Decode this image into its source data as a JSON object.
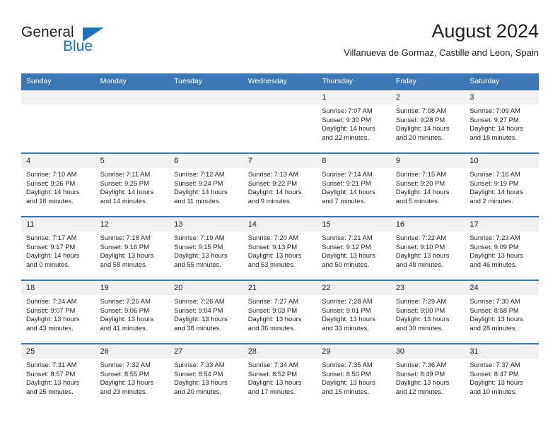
{
  "brand": {
    "name_part1": "General",
    "name_part2": "Blue",
    "triangle_icon": "triangle-icon",
    "accent_color": "#1b75bb"
  },
  "header": {
    "title": "August 2024",
    "subtitle": "Villanueva de Gormaz, Castille and Leon, Spain"
  },
  "colors": {
    "header_blue": "#3c78b4",
    "daynum_bg": "#f0f0f0",
    "text": "#231f20"
  },
  "weekday_headers": [
    "Sunday",
    "Monday",
    "Tuesday",
    "Wednesday",
    "Thursday",
    "Friday",
    "Saturday"
  ],
  "weeks": [
    [
      {
        "day": "",
        "sunrise": "",
        "sunset": "",
        "daylight_line1": "",
        "daylight_line2": ""
      },
      {
        "day": "",
        "sunrise": "",
        "sunset": "",
        "daylight_line1": "",
        "daylight_line2": ""
      },
      {
        "day": "",
        "sunrise": "",
        "sunset": "",
        "daylight_line1": "",
        "daylight_line2": ""
      },
      {
        "day": "",
        "sunrise": "",
        "sunset": "",
        "daylight_line1": "",
        "daylight_line2": ""
      },
      {
        "day": "1",
        "sunrise": "Sunrise: 7:07 AM",
        "sunset": "Sunset: 9:30 PM",
        "daylight_line1": "Daylight: 14 hours",
        "daylight_line2": "and 22 minutes."
      },
      {
        "day": "2",
        "sunrise": "Sunrise: 7:08 AM",
        "sunset": "Sunset: 9:28 PM",
        "daylight_line1": "Daylight: 14 hours",
        "daylight_line2": "and 20 minutes."
      },
      {
        "day": "3",
        "sunrise": "Sunrise: 7:09 AM",
        "sunset": "Sunset: 9:27 PM",
        "daylight_line1": "Daylight: 14 hours",
        "daylight_line2": "and 18 minutes."
      }
    ],
    [
      {
        "day": "4",
        "sunrise": "Sunrise: 7:10 AM",
        "sunset": "Sunset: 9:26 PM",
        "daylight_line1": "Daylight: 14 hours",
        "daylight_line2": "and 16 minutes."
      },
      {
        "day": "5",
        "sunrise": "Sunrise: 7:11 AM",
        "sunset": "Sunset: 9:25 PM",
        "daylight_line1": "Daylight: 14 hours",
        "daylight_line2": "and 14 minutes."
      },
      {
        "day": "6",
        "sunrise": "Sunrise: 7:12 AM",
        "sunset": "Sunset: 9:24 PM",
        "daylight_line1": "Daylight: 14 hours",
        "daylight_line2": "and 11 minutes."
      },
      {
        "day": "7",
        "sunrise": "Sunrise: 7:13 AM",
        "sunset": "Sunset: 9:22 PM",
        "daylight_line1": "Daylight: 14 hours",
        "daylight_line2": "and 9 minutes."
      },
      {
        "day": "8",
        "sunrise": "Sunrise: 7:14 AM",
        "sunset": "Sunset: 9:21 PM",
        "daylight_line1": "Daylight: 14 hours",
        "daylight_line2": "and 7 minutes."
      },
      {
        "day": "9",
        "sunrise": "Sunrise: 7:15 AM",
        "sunset": "Sunset: 9:20 PM",
        "daylight_line1": "Daylight: 14 hours",
        "daylight_line2": "and 5 minutes."
      },
      {
        "day": "10",
        "sunrise": "Sunrise: 7:16 AM",
        "sunset": "Sunset: 9:19 PM",
        "daylight_line1": "Daylight: 14 hours",
        "daylight_line2": "and 2 minutes."
      }
    ],
    [
      {
        "day": "11",
        "sunrise": "Sunrise: 7:17 AM",
        "sunset": "Sunset: 9:17 PM",
        "daylight_line1": "Daylight: 14 hours",
        "daylight_line2": "and 0 minutes."
      },
      {
        "day": "12",
        "sunrise": "Sunrise: 7:18 AM",
        "sunset": "Sunset: 9:16 PM",
        "daylight_line1": "Daylight: 13 hours",
        "daylight_line2": "and 58 minutes."
      },
      {
        "day": "13",
        "sunrise": "Sunrise: 7:19 AM",
        "sunset": "Sunset: 9:15 PM",
        "daylight_line1": "Daylight: 13 hours",
        "daylight_line2": "and 55 minutes."
      },
      {
        "day": "14",
        "sunrise": "Sunrise: 7:20 AM",
        "sunset": "Sunset: 9:13 PM",
        "daylight_line1": "Daylight: 13 hours",
        "daylight_line2": "and 53 minutes."
      },
      {
        "day": "15",
        "sunrise": "Sunrise: 7:21 AM",
        "sunset": "Sunset: 9:12 PM",
        "daylight_line1": "Daylight: 13 hours",
        "daylight_line2": "and 50 minutes."
      },
      {
        "day": "16",
        "sunrise": "Sunrise: 7:22 AM",
        "sunset": "Sunset: 9:10 PM",
        "daylight_line1": "Daylight: 13 hours",
        "daylight_line2": "and 48 minutes."
      },
      {
        "day": "17",
        "sunrise": "Sunrise: 7:23 AM",
        "sunset": "Sunset: 9:09 PM",
        "daylight_line1": "Daylight: 13 hours",
        "daylight_line2": "and 46 minutes."
      }
    ],
    [
      {
        "day": "18",
        "sunrise": "Sunrise: 7:24 AM",
        "sunset": "Sunset: 9:07 PM",
        "daylight_line1": "Daylight: 13 hours",
        "daylight_line2": "and 43 minutes."
      },
      {
        "day": "19",
        "sunrise": "Sunrise: 7:25 AM",
        "sunset": "Sunset: 9:06 PM",
        "daylight_line1": "Daylight: 13 hours",
        "daylight_line2": "and 41 minutes."
      },
      {
        "day": "20",
        "sunrise": "Sunrise: 7:26 AM",
        "sunset": "Sunset: 9:04 PM",
        "daylight_line1": "Daylight: 13 hours",
        "daylight_line2": "and 38 minutes."
      },
      {
        "day": "21",
        "sunrise": "Sunrise: 7:27 AM",
        "sunset": "Sunset: 9:03 PM",
        "daylight_line1": "Daylight: 13 hours",
        "daylight_line2": "and 36 minutes."
      },
      {
        "day": "22",
        "sunrise": "Sunrise: 7:28 AM",
        "sunset": "Sunset: 9:01 PM",
        "daylight_line1": "Daylight: 13 hours",
        "daylight_line2": "and 33 minutes."
      },
      {
        "day": "23",
        "sunrise": "Sunrise: 7:29 AM",
        "sunset": "Sunset: 9:00 PM",
        "daylight_line1": "Daylight: 13 hours",
        "daylight_line2": "and 30 minutes."
      },
      {
        "day": "24",
        "sunrise": "Sunrise: 7:30 AM",
        "sunset": "Sunset: 8:58 PM",
        "daylight_line1": "Daylight: 13 hours",
        "daylight_line2": "and 28 minutes."
      }
    ],
    [
      {
        "day": "25",
        "sunrise": "Sunrise: 7:31 AM",
        "sunset": "Sunset: 8:57 PM",
        "daylight_line1": "Daylight: 13 hours",
        "daylight_line2": "and 25 minutes."
      },
      {
        "day": "26",
        "sunrise": "Sunrise: 7:32 AM",
        "sunset": "Sunset: 8:55 PM",
        "daylight_line1": "Daylight: 13 hours",
        "daylight_line2": "and 23 minutes."
      },
      {
        "day": "27",
        "sunrise": "Sunrise: 7:33 AM",
        "sunset": "Sunset: 8:54 PM",
        "daylight_line1": "Daylight: 13 hours",
        "daylight_line2": "and 20 minutes."
      },
      {
        "day": "28",
        "sunrise": "Sunrise: 7:34 AM",
        "sunset": "Sunset: 8:52 PM",
        "daylight_line1": "Daylight: 13 hours",
        "daylight_line2": "and 17 minutes."
      },
      {
        "day": "29",
        "sunrise": "Sunrise: 7:35 AM",
        "sunset": "Sunset: 8:50 PM",
        "daylight_line1": "Daylight: 13 hours",
        "daylight_line2": "and 15 minutes."
      },
      {
        "day": "30",
        "sunrise": "Sunrise: 7:36 AM",
        "sunset": "Sunset: 8:49 PM",
        "daylight_line1": "Daylight: 13 hours",
        "daylight_line2": "and 12 minutes."
      },
      {
        "day": "31",
        "sunrise": "Sunrise: 7:37 AM",
        "sunset": "Sunset: 8:47 PM",
        "daylight_line1": "Daylight: 13 hours",
        "daylight_line2": "and 10 minutes."
      }
    ]
  ]
}
